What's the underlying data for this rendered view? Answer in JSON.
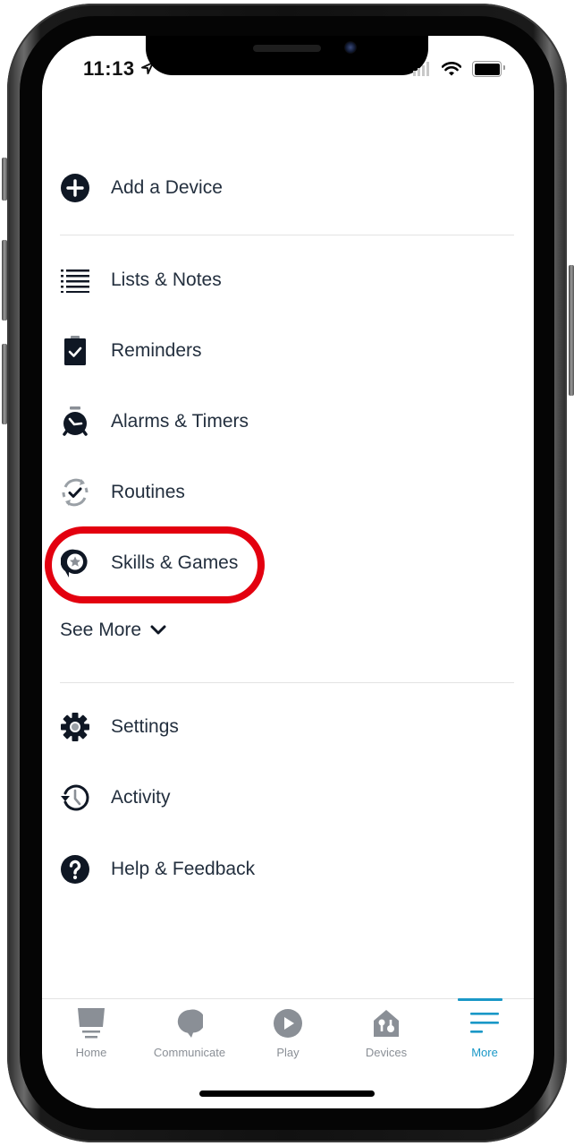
{
  "status_bar": {
    "time": "11:13",
    "icons": [
      "location-arrow-icon",
      "cellular-signal-icon",
      "wifi-icon",
      "battery-icon"
    ]
  },
  "menu": {
    "primary": [
      {
        "label": "Add a Device",
        "icon": "add-circle-icon"
      }
    ],
    "features": [
      {
        "label": "Lists & Notes",
        "icon": "list-icon"
      },
      {
        "label": "Reminders",
        "icon": "clipboard-check-icon"
      },
      {
        "label": "Alarms & Timers",
        "icon": "alarm-clock-icon"
      },
      {
        "label": "Routines",
        "icon": "routine-check-icon"
      },
      {
        "label": "Skills & Games",
        "icon": "skills-star-bubble-icon",
        "highlighted": true
      }
    ],
    "see_more": {
      "label": "See More",
      "icon": "chevron-down-icon"
    },
    "secondary": [
      {
        "label": "Settings",
        "icon": "gear-icon"
      },
      {
        "label": "Activity",
        "icon": "history-icon"
      },
      {
        "label": "Help & Feedback",
        "icon": "help-icon"
      }
    ]
  },
  "annotation": {
    "highlight_target": "Skills & Games",
    "color": "#e3000f"
  },
  "tab_bar": {
    "active": "More",
    "accent_color": "#1a98c7",
    "inactive_color": "#8a8f96",
    "tabs": [
      {
        "label": "Home",
        "icon": "home-device-icon"
      },
      {
        "label": "Communicate",
        "icon": "speech-bubble-icon"
      },
      {
        "label": "Play",
        "icon": "play-icon"
      },
      {
        "label": "Devices",
        "icon": "devices-house-icon"
      },
      {
        "label": "More",
        "icon": "menu-lines-icon"
      }
    ]
  }
}
